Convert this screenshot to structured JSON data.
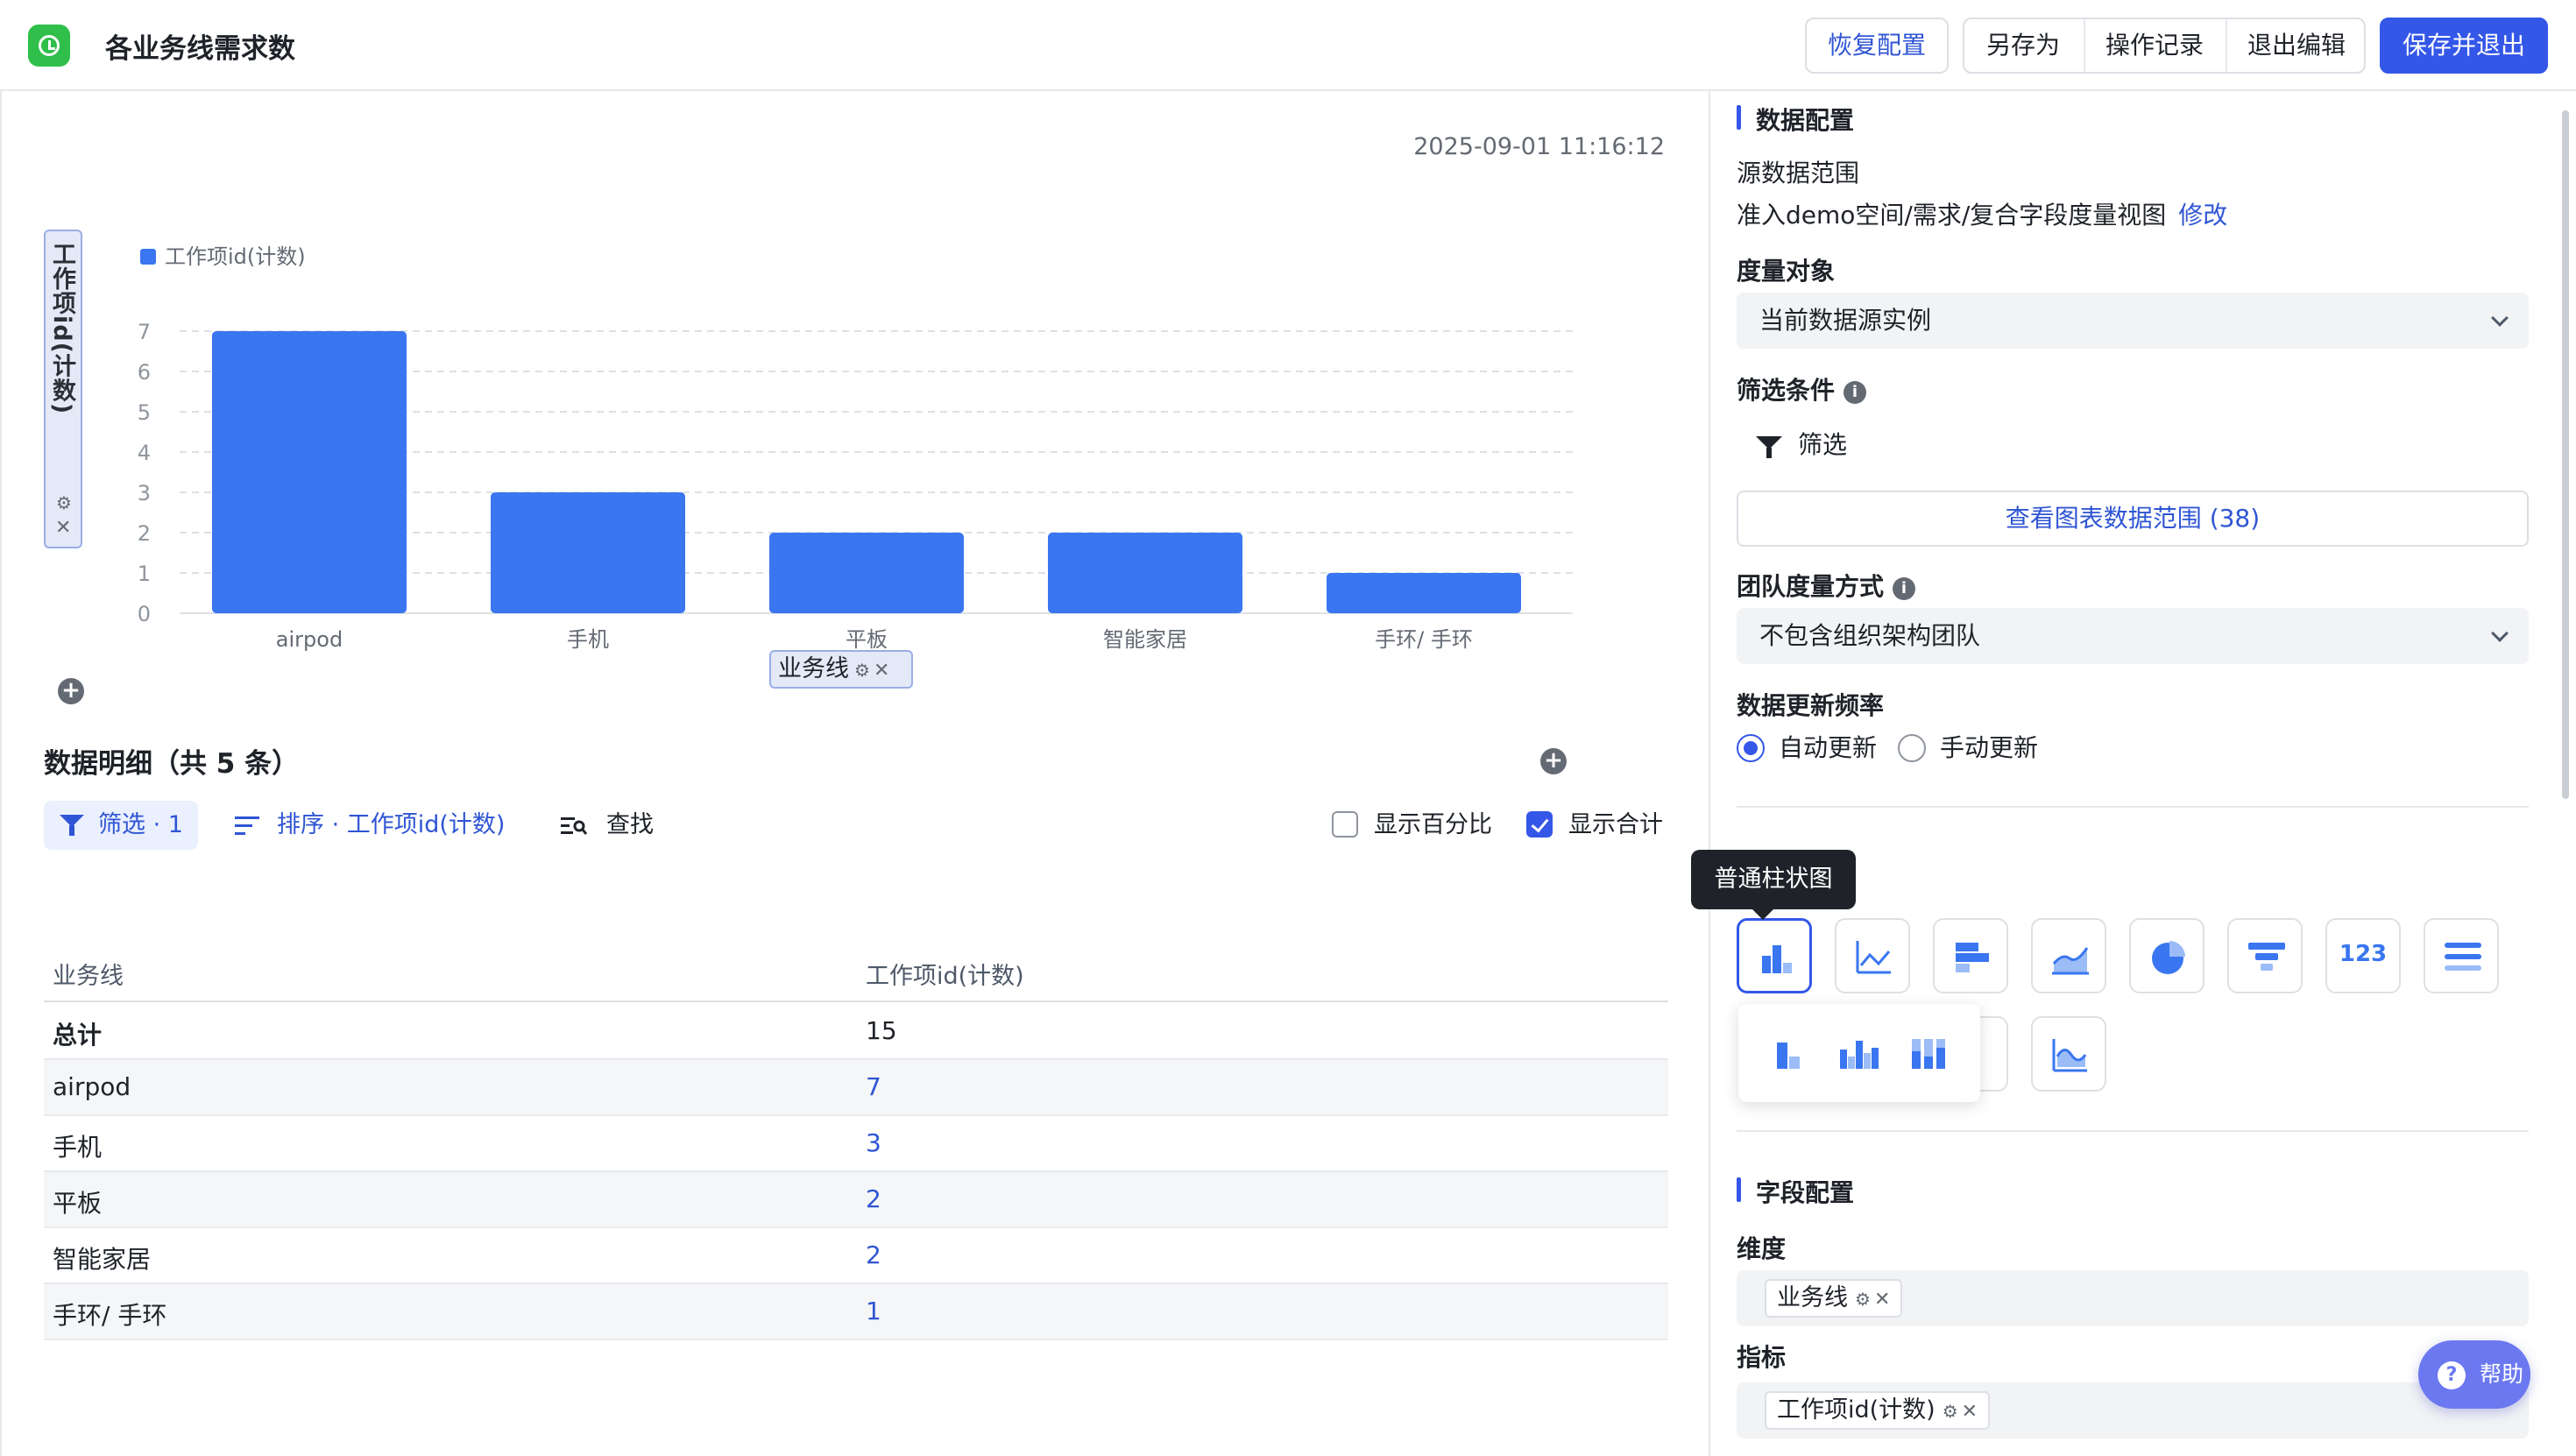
{
  "header": {
    "title": "各业务线需求数",
    "restore_label": "恢复配置",
    "save_as_label": "另存为",
    "history_label": "操作记录",
    "exit_edit_label": "退出编辑",
    "save_exit_label": "保存并退出"
  },
  "timestamp": "2025-09-01 11:16:12",
  "chart_data": {
    "type": "bar",
    "categories": [
      "airpod",
      "手机",
      "平板",
      "智能家居",
      "手环/ 手环"
    ],
    "series": [
      {
        "name": "工作项id(计数)",
        "values": [
          7,
          3,
          2,
          2,
          1
        ],
        "color": "#3a76f0"
      }
    ],
    "y_ticks": [
      0,
      1,
      2,
      3,
      4,
      5,
      6,
      7
    ],
    "ylim": [
      0,
      7
    ],
    "ylabel": "工作项id(计数)",
    "xlabel": "业务线",
    "legend": "top-left",
    "grid": true
  },
  "y_axis_field": "工作项id(计数)",
  "x_axis_field": "业务线",
  "detail": {
    "title": "数据明细（共 5 条）",
    "filter_label": "筛选 · 1",
    "sort_label": "排序 · 工作项id(计数)",
    "find_label": "查找",
    "show_percent_label": "显示百分比",
    "show_total_label": "显示合计",
    "show_percent": false,
    "show_total": true,
    "columns": [
      "业务线",
      "工作项id(计数)"
    ],
    "rows": [
      {
        "name": "总计",
        "value": "15"
      },
      {
        "name": "airpod",
        "value": "7"
      },
      {
        "name": "手机",
        "value": "3"
      },
      {
        "name": "平板",
        "value": "2"
      },
      {
        "name": "智能家居",
        "value": "2"
      },
      {
        "name": "手环/ 手环",
        "value": "1"
      }
    ]
  },
  "config": {
    "data_section": "数据配置",
    "source_label": "源数据范围",
    "source_value": "准入demo空间/需求/复合字段度量视图",
    "modify_label": "修改",
    "measure_target_label": "度量对象",
    "measure_target_value": "当前数据源实例",
    "filter_cond_label": "筛选条件",
    "filter_btn_label": "筛选",
    "view_range_label": "查看图表数据范围 (38)",
    "team_measure_label": "团队度量方式",
    "team_measure_value": "不包含组织架构团队",
    "update_freq_label": "数据更新频率",
    "auto_update_label": "自动更新",
    "manual_update_label": "手动更新",
    "update_mode": "auto",
    "chart_tooltip": "普通柱状图",
    "number_chart_label": "123",
    "field_section": "字段配置",
    "dimension_label": "维度",
    "dimension_value": "业务线",
    "metric_label": "指标",
    "metric_value": "工作项id(计数)"
  },
  "help_label": "帮助"
}
